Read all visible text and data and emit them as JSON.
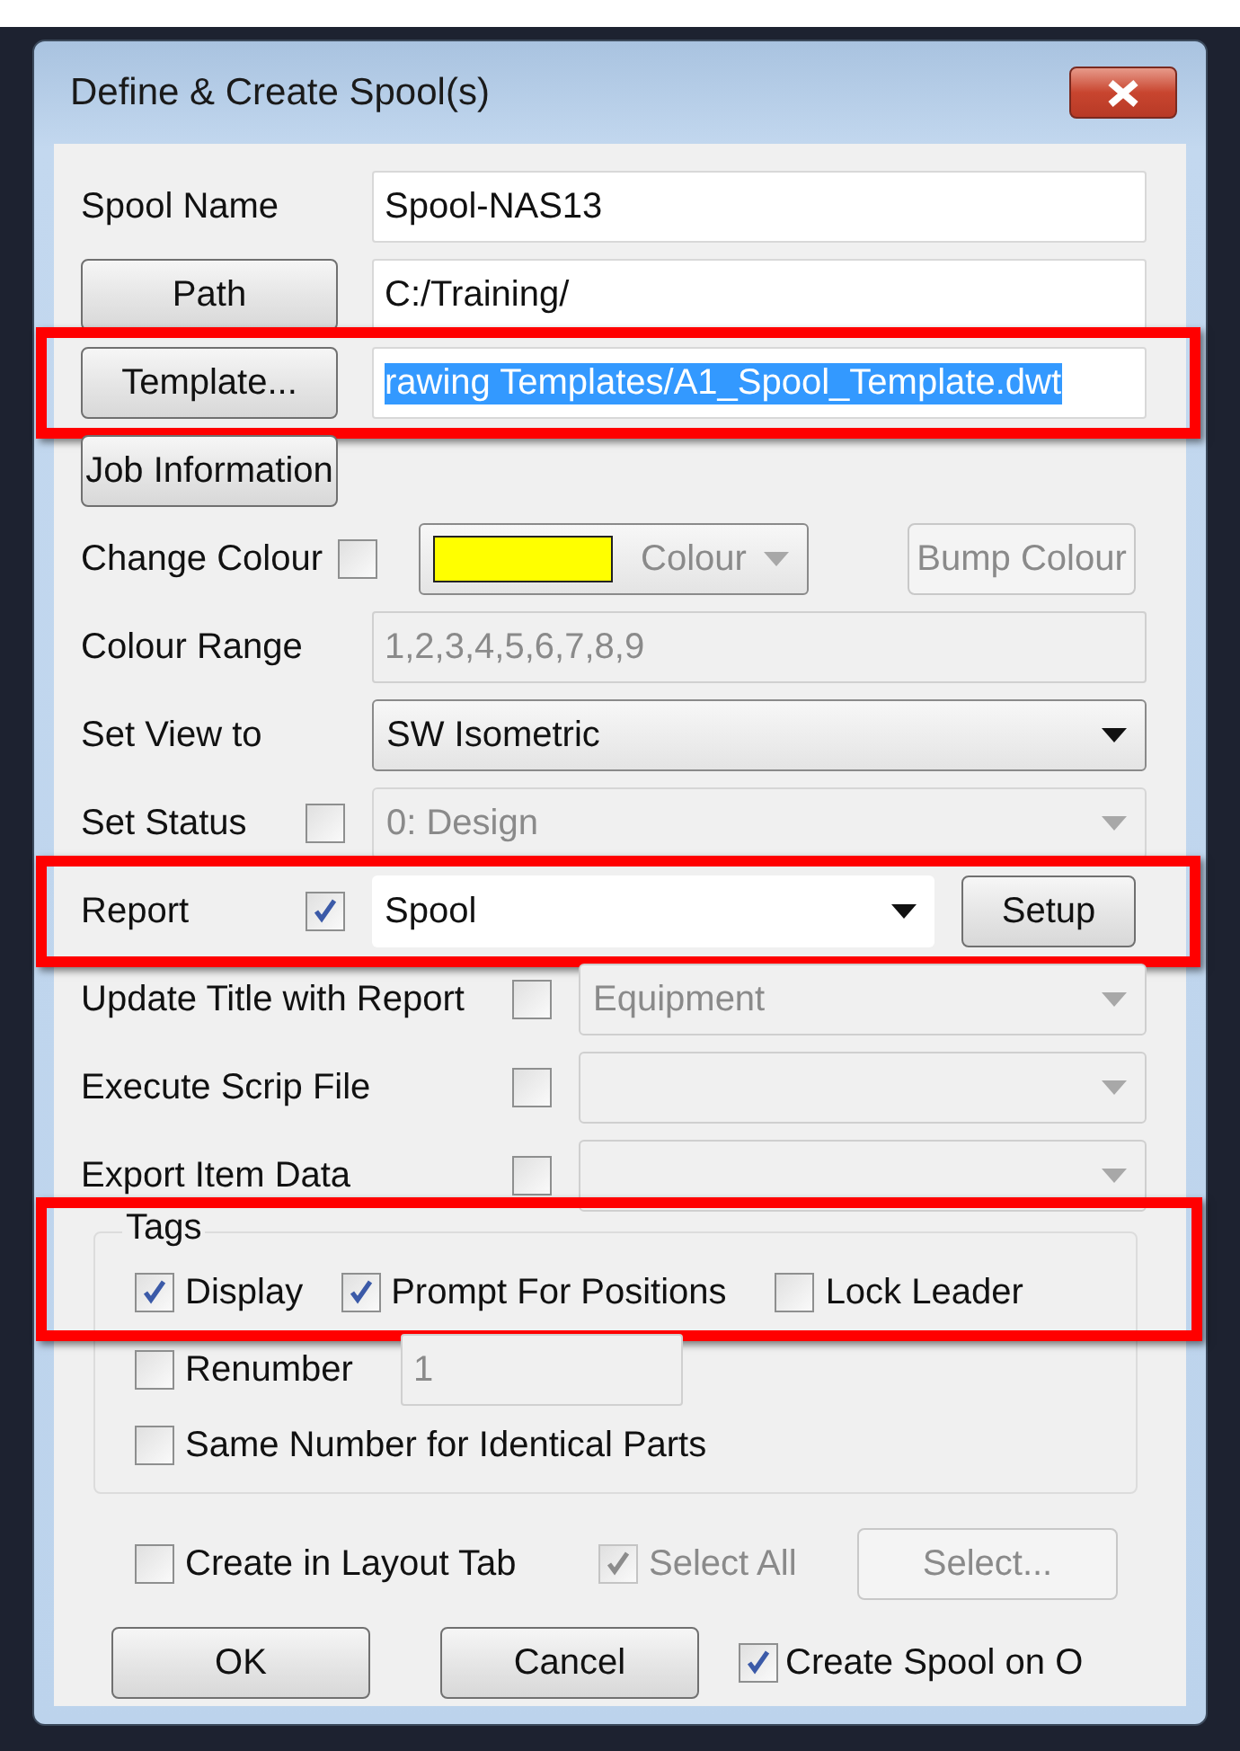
{
  "window": {
    "title": "Define & Create Spool(s)"
  },
  "rows": [
    {
      "kind": "text",
      "label": "Spool Name",
      "value": "Spool-NAS13",
      "disabled": false
    },
    {
      "kind": "button-text",
      "button": "Path",
      "value": "C:/Training/",
      "text_selected": false
    },
    {
      "kind": "button-text",
      "button": "Template...",
      "value": "rawing Templates/A1_Spool_Template.dwt",
      "highlighted": true,
      "text_selected": true
    },
    {
      "kind": "button",
      "button": "Job Information"
    },
    {
      "kind": "colour",
      "label": "Change Colour",
      "checked": false,
      "color": "#ffff00",
      "dropdown": "Colour",
      "button": "Bump Colour",
      "disabled": true
    },
    {
      "kind": "text",
      "label": "Colour Range",
      "value": "1,2,3,4,5,6,7,8,9",
      "disabled": true
    },
    {
      "kind": "combo",
      "label": "Set View to",
      "value": "SW Isometric",
      "disabled": false
    },
    {
      "kind": "check-combo",
      "label": "Set Status",
      "checked": false,
      "value": "0: Design",
      "disabled": true
    },
    {
      "kind": "check-combo",
      "label": "Report",
      "checked": true,
      "value": "Spool",
      "disabled": false,
      "button": "Setup",
      "highlighted": true
    },
    {
      "kind": "wide-check-combo",
      "label": "Update Title with Report",
      "checked": false,
      "value": "Equipment",
      "disabled": true
    },
    {
      "kind": "wide-check-combo",
      "label": "Execute Scrip File",
      "checked": false,
      "disabled": true
    },
    {
      "kind": "wide-check-combo",
      "label": "Export Item Data",
      "checked": false,
      "disabled": true
    }
  ],
  "tags": {
    "title": "Tags",
    "highlighted": true,
    "options": [
      {
        "label": "Display",
        "checked": true
      },
      {
        "label": "Prompt For Positions",
        "checked": true
      },
      {
        "label": "Lock Leader",
        "checked": false
      }
    ],
    "renumber": {
      "label": "Renumber",
      "checked": false,
      "value": "1",
      "disabled": true
    },
    "same_number": {
      "label": "Same Number for Identical Parts",
      "checked": false
    }
  },
  "create_in_layout": {
    "label": "Create in Layout Tab",
    "checked": false
  },
  "select_all": {
    "label": "Select All",
    "checked": true,
    "disabled": true
  },
  "select_button": {
    "label": "Select...",
    "disabled": true
  },
  "buttons": [
    "OK",
    "Cancel"
  ],
  "create_spool": {
    "label": "Create Spool on O",
    "checked": true
  }
}
